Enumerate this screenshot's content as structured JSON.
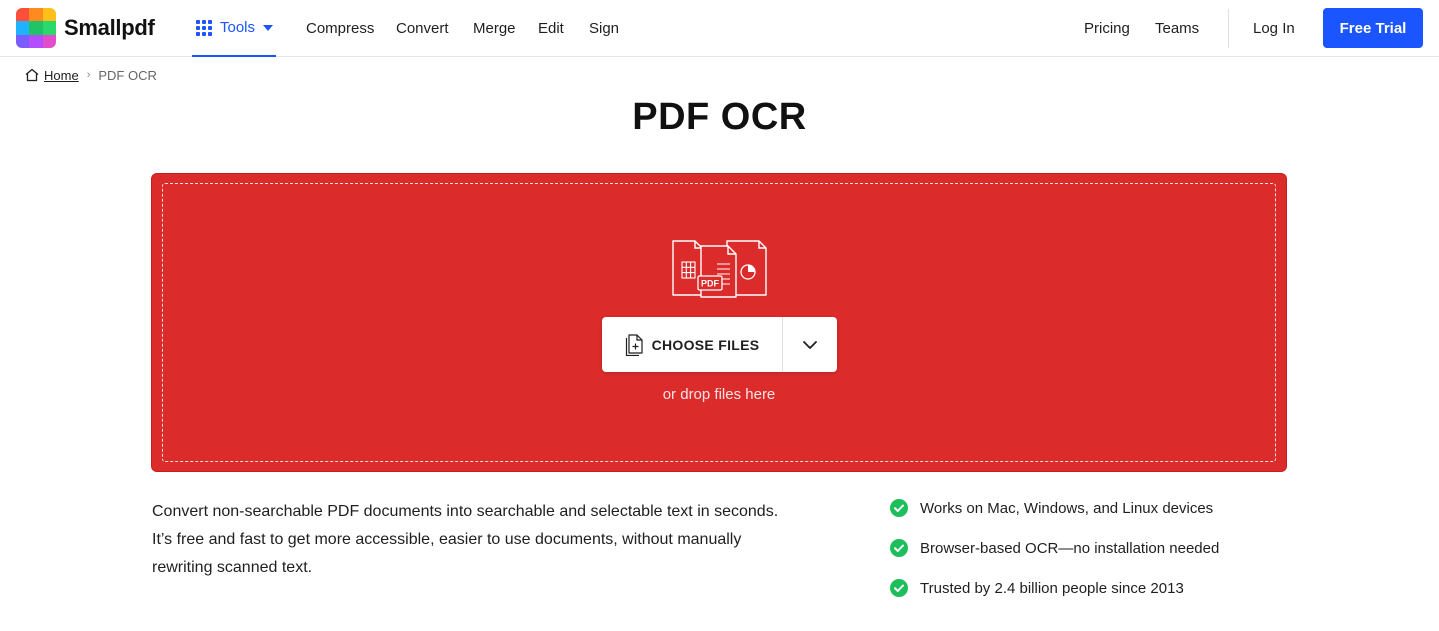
{
  "brand": {
    "name": "Smallpdf",
    "logo_colors": [
      "#ff4f3a",
      "#ff8a1f",
      "#ffbf1a",
      "#1fb2ff",
      "#1fc466",
      "#2bd86a",
      "#7b5cff",
      "#b44dff",
      "#e24dcb"
    ]
  },
  "nav": {
    "tools_label": "Tools",
    "items": [
      "Compress",
      "Convert",
      "Merge",
      "Edit",
      "Sign"
    ],
    "right": {
      "pricing": "Pricing",
      "teams": "Teams",
      "login": "Log In",
      "trial": "Free Trial"
    }
  },
  "breadcrumb": {
    "home": "Home",
    "separator": "›",
    "current": "PDF OCR"
  },
  "page": {
    "title": "PDF OCR"
  },
  "dropzone": {
    "button_label": "CHOOSE FILES",
    "hint": "or drop files here",
    "art_badge": "PDF"
  },
  "description": "Convert non-searchable PDF documents into searchable and selectable text in seconds. It’s free and fast to get more accessible, easier to use documents, without manually rewriting scanned text.",
  "features": [
    "Works on Mac, Windows, and Linux devices",
    "Browser-based OCR—no installation needed",
    "Trusted by 2.4 billion people since 2013"
  ],
  "colors": {
    "accent": "#1a55ff",
    "dropzone": "#db2b2b",
    "check": "#1dbf5b"
  },
  "icons": {
    "logo": "smallpdf-logo-icon",
    "tools": "grid-icon",
    "caret": "caret-down-icon",
    "home": "home-icon",
    "file_add": "file-add-icon",
    "chevron": "chevron-down-icon",
    "check": "check-circle-icon"
  }
}
